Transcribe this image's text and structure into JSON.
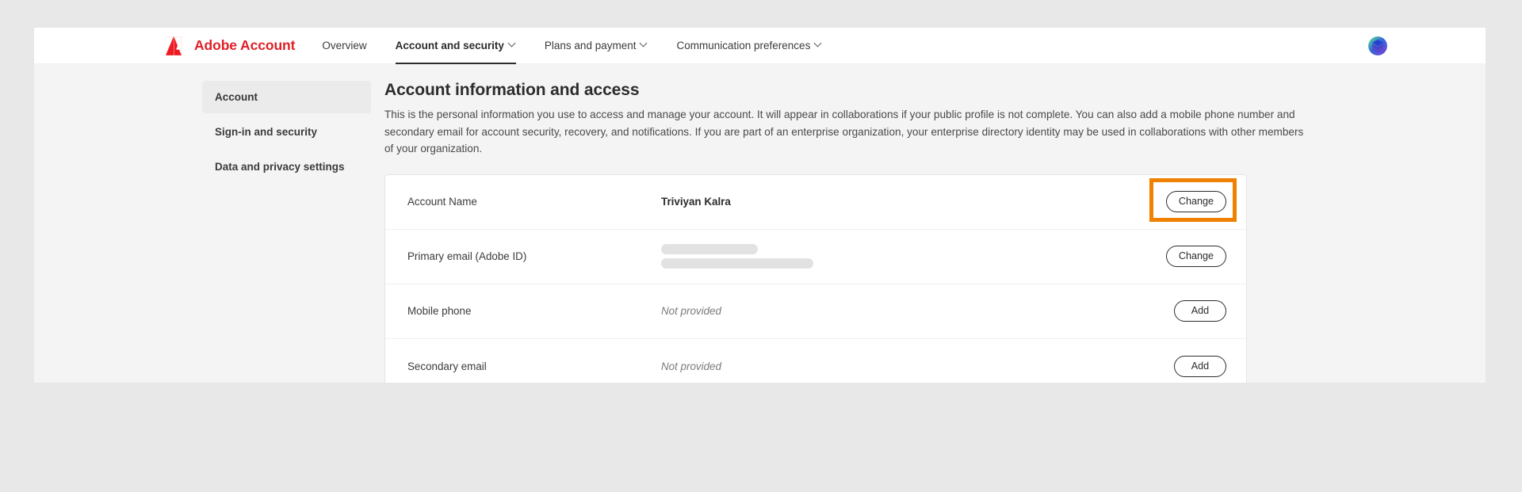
{
  "brand": {
    "name": "Adobe Account",
    "logo_icon": "adobe-logo-icon",
    "logo_color": "#e01f27"
  },
  "topnav": {
    "items": [
      {
        "label": "Overview",
        "has_caret": false,
        "active": false
      },
      {
        "label": "Account and security",
        "has_caret": true,
        "active": true
      },
      {
        "label": "Plans and payment",
        "has_caret": true,
        "active": false
      },
      {
        "label": "Communication preferences",
        "has_caret": true,
        "active": false
      }
    ],
    "avatar_icon": "user-avatar-icon"
  },
  "sidebar": {
    "items": [
      {
        "label": "Account",
        "active": true
      },
      {
        "label": "Sign-in and security",
        "active": false
      },
      {
        "label": "Data and privacy settings",
        "active": false
      }
    ]
  },
  "main": {
    "title": "Account information and access",
    "description": "This is the personal information you use to access and manage your account. It will appear in collaborations if your public profile is not complete. You can also add a mobile phone number and secondary email for account security, recovery, and notifications. If you are part of an enterprise organization, your enterprise directory identity may be used in collaborations with other members of your organization.",
    "rows": [
      {
        "label": "Account Name",
        "value": "Triviyan Kalra",
        "value_style": "bold",
        "action_label": "Change",
        "highlighted": true
      },
      {
        "label": "Primary email (Adobe ID)",
        "value": "",
        "value_style": "redacted",
        "action_label": "Change",
        "highlighted": false
      },
      {
        "label": "Mobile phone",
        "value": "Not provided",
        "value_style": "muted",
        "action_label": "Add",
        "highlighted": false
      },
      {
        "label": "Secondary email",
        "value": "Not provided",
        "value_style": "muted",
        "action_label": "Add",
        "highlighted": false
      }
    ]
  },
  "colors": {
    "adobe_red": "#e01f27",
    "highlight_orange": "#f08000",
    "page_background": "#f4f4f4",
    "outer_background": "#e8e8e8",
    "card_background": "#ffffff"
  }
}
